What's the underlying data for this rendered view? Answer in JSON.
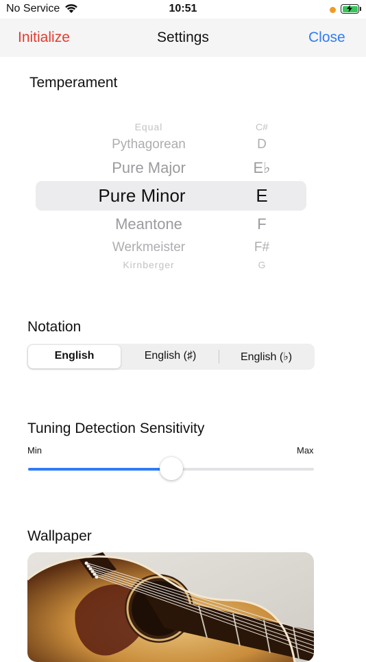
{
  "status_bar": {
    "carrier": "No Service",
    "time": "10:51",
    "wifi_icon": "wifi-icon",
    "battery_icon": "battery-charging-icon"
  },
  "nav": {
    "left_label": "Initialize",
    "title": "Settings",
    "right_label": "Close",
    "left_color": "#e53a2f",
    "right_color": "#2f7cf6"
  },
  "temperament": {
    "title": "Temperament",
    "temperaments": [
      "Equal",
      "Pythagorean",
      "Pure Major",
      "Pure Minor",
      "Meantone",
      "Werkmeister",
      "Kirnberger"
    ],
    "selected_temperament": "Pure Minor",
    "keys": [
      "C#",
      "D",
      "E♭",
      "E",
      "F",
      "F#",
      "G"
    ],
    "selected_key": "E"
  },
  "notation": {
    "title": "Notation",
    "options": [
      "English",
      "English (♯)",
      "English (♭)"
    ],
    "selected": "English"
  },
  "sensitivity": {
    "title": "Tuning Detection Sensitivity",
    "min_label": "Min",
    "max_label": "Max",
    "value": 0.5,
    "accent": "#2f7cf6"
  },
  "wallpaper": {
    "title": "Wallpaper"
  }
}
